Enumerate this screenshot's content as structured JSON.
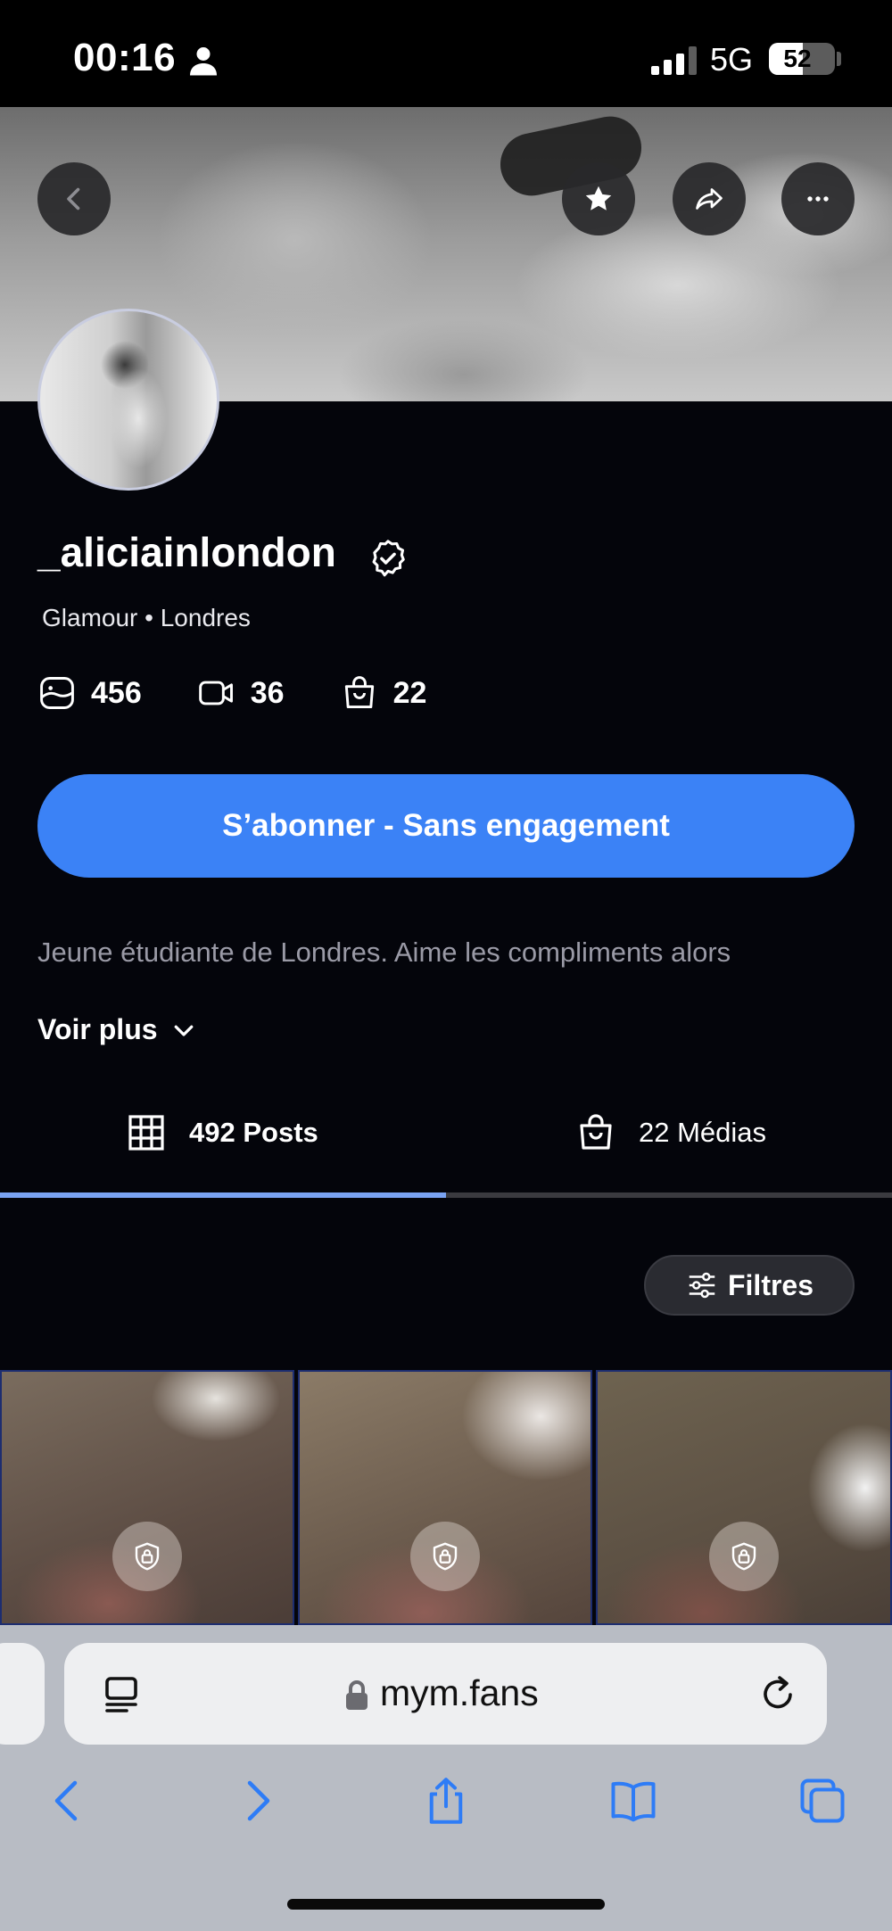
{
  "status_bar": {
    "time": "00:16",
    "network": "5G",
    "battery": "52",
    "battery_level": 0.52
  },
  "banner": {
    "back_icon": "chevron-left-icon",
    "favorite_icon": "star-icon",
    "share_icon": "share-arrow-icon",
    "more_icon": "more-dots-icon"
  },
  "profile": {
    "username": "_aliciainlondon",
    "verified_icon": "verified-badge-icon",
    "subtitle": "Glamour • Londres",
    "stats": [
      {
        "icon": "photo-icon",
        "value": "456"
      },
      {
        "icon": "video-icon",
        "value": "36"
      },
      {
        "icon": "bag-icon",
        "value": "22"
      }
    ],
    "subscribe_label": "S’abonner - Sans engagement",
    "bio": "Jeune étudiante de Londres. Aime les compliments alors",
    "see_more_label": "Voir plus"
  },
  "tabs": [
    {
      "label": "492 Posts",
      "icon": "grid-icon",
      "active": true
    },
    {
      "label": "22 Médias",
      "icon": "bag-icon",
      "active": false
    }
  ],
  "filters_label": "Filtres",
  "grid_items": [
    {
      "locked": true,
      "icon": "lock-icon"
    },
    {
      "locked": true,
      "icon": "lock-icon"
    },
    {
      "locked": true,
      "icon": "lock-icon"
    }
  ],
  "browser": {
    "url": "mym.fans",
    "toolbar": [
      "back-icon",
      "forward-icon",
      "share-icon",
      "bookmarks-icon",
      "tabs-icon"
    ]
  },
  "colors": {
    "accent": "#3b82f6",
    "background": "#04050b",
    "tab_indicator": "#7aa3f2",
    "browser_toolbar": "#2e7cf6"
  }
}
